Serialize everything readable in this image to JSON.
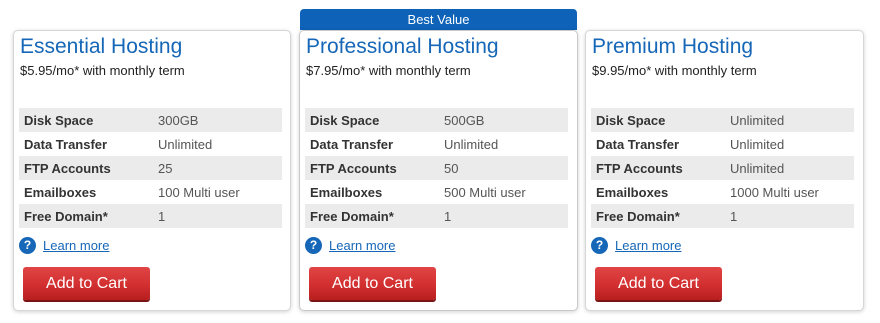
{
  "ribbon": {
    "label": "Best Value"
  },
  "plans": [
    {
      "title": "Essential Hosting",
      "price": "$5.95/mo* with monthly term",
      "specs": [
        {
          "label": "Disk Space",
          "value": "300GB"
        },
        {
          "label": "Data Transfer",
          "value": "Unlimited"
        },
        {
          "label": "FTP Accounts",
          "value": "25"
        },
        {
          "label": "Emailboxes",
          "value": "100 Multi user"
        },
        {
          "label": "Free Domain*",
          "value": "1"
        }
      ],
      "learn_more": "Learn more",
      "cta": "Add to Cart"
    },
    {
      "title": "Professional Hosting",
      "price": "$7.95/mo* with monthly term",
      "specs": [
        {
          "label": "Disk Space",
          "value": "500GB"
        },
        {
          "label": "Data Transfer",
          "value": "Unlimited"
        },
        {
          "label": "FTP Accounts",
          "value": "50"
        },
        {
          "label": "Emailboxes",
          "value": "500 Multi user"
        },
        {
          "label": "Free Domain*",
          "value": "1"
        }
      ],
      "learn_more": "Learn more",
      "cta": "Add to Cart"
    },
    {
      "title": "Premium Hosting",
      "price": "$9.95/mo* with monthly term",
      "specs": [
        {
          "label": "Disk Space",
          "value": "Unlimited"
        },
        {
          "label": "Data Transfer",
          "value": "Unlimited"
        },
        {
          "label": "FTP Accounts",
          "value": "Unlimited"
        },
        {
          "label": "Emailboxes",
          "value": "1000 Multi user"
        },
        {
          "label": "Free Domain*",
          "value": "1"
        }
      ],
      "learn_more": "Learn more",
      "cta": "Add to Cart"
    }
  ],
  "icons": {
    "help": "question-circle-icon",
    "help_glyph": "?"
  },
  "colors": {
    "title": "#1667b8",
    "ribbon": "#0e62b8",
    "button": "#d22f30",
    "row_alt": "#ebebeb"
  }
}
